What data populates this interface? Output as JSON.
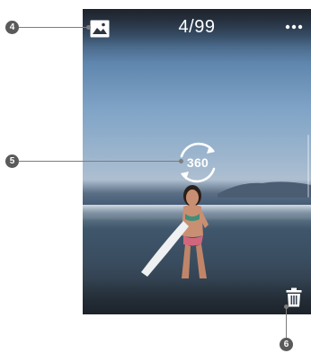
{
  "viewer": {
    "counter": "4/99",
    "view360_label": "360"
  },
  "icons": {
    "gallery": "photo-icon",
    "more": "more-horizontal-icon",
    "view360": "rotate-360-icon",
    "delete": "trash-icon"
  },
  "callouts": [
    {
      "number": "4",
      "target": "photo-icon"
    },
    {
      "number": "5",
      "target": "rotate-360-icon"
    },
    {
      "number": "6",
      "target": "trash-icon"
    }
  ],
  "colors": {
    "callout_badge": "#5a5a5a",
    "callout_line": "#7d7d7d",
    "overlay_icon": "#ffffff"
  }
}
